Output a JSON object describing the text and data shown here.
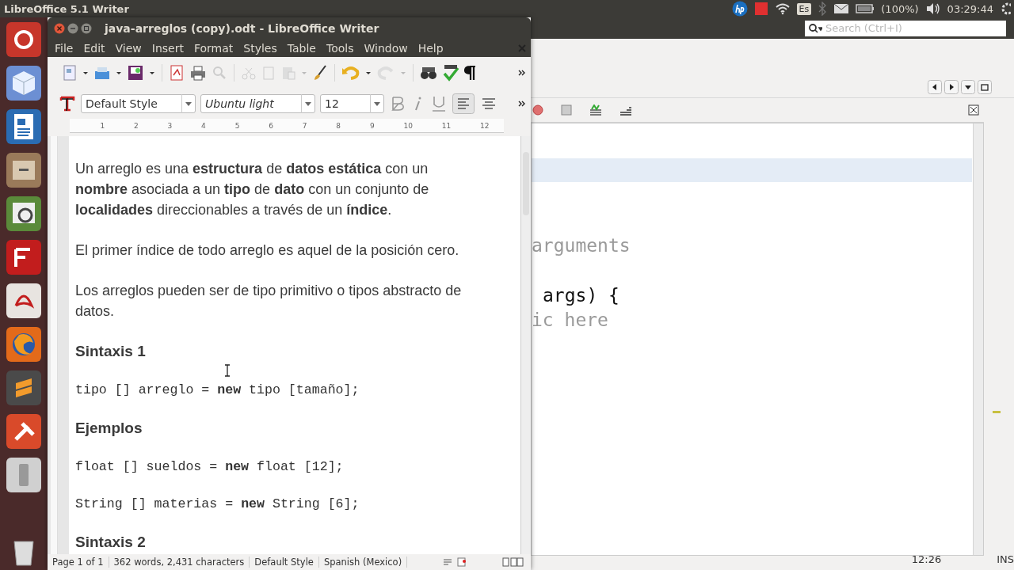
{
  "top_bar": {
    "app_name": "LibreOffice 5.1 Writer",
    "keyboard": "Es",
    "battery": "(100%)",
    "clock": "03:29:44"
  },
  "background_window": {
    "search_placeholder": "Search (Ctrl+I)",
    "code_lines": [
      {
        "text": "arguments",
        "kind": "comment"
      },
      {
        "text": "args) {",
        "kind": "code"
      },
      {
        "text": "ic here",
        "kind": "comment"
      }
    ],
    "status": [
      "12:26",
      "INS"
    ]
  },
  "writer": {
    "title": "java-arreglos (copy).odt - LibreOffice Writer",
    "menu": [
      "File",
      "Edit",
      "View",
      "Insert",
      "Format",
      "Styles",
      "Table",
      "Tools",
      "Window",
      "Help"
    ],
    "paragraph_style": "Default Style",
    "font_name": "Ubuntu light",
    "font_size": "12",
    "ruler": [
      "1",
      "2",
      "3",
      "4",
      "5",
      "6",
      "7",
      "8",
      "9",
      "10",
      "11",
      "12"
    ],
    "document": [
      {
        "kind": "text",
        "text": "Un arreglo es una **estructura** de **datos estática** con un **nombre** asociada a un **tipo** de **dato** con un conjunto de **localidades** direccionables a través de un **índice**."
      },
      {
        "kind": "text",
        "text": "El primer índice de todo arreglo es aquel de la posición cero."
      },
      {
        "kind": "text",
        "text": "Los arreglos pueden ser de tipo primitivo o tipos abstracto de datos."
      },
      {
        "kind": "heading",
        "text": "Sintaxis 1"
      },
      {
        "kind": "code",
        "text": "tipo [] arreglo = **new** tipo [tamaño];"
      },
      {
        "kind": "heading",
        "text": "Ejemplos"
      },
      {
        "kind": "code",
        "text": "float [] sueldos = **new** float [12];"
      },
      {
        "kind": "code",
        "text": "String [] materias = **new** String [6];"
      },
      {
        "kind": "heading",
        "text": "Sintaxis 2"
      }
    ],
    "status": [
      "Page 1 of 1",
      "362 words, 2,431 characters",
      "Default Style",
      "Spanish (Mexico)"
    ]
  }
}
